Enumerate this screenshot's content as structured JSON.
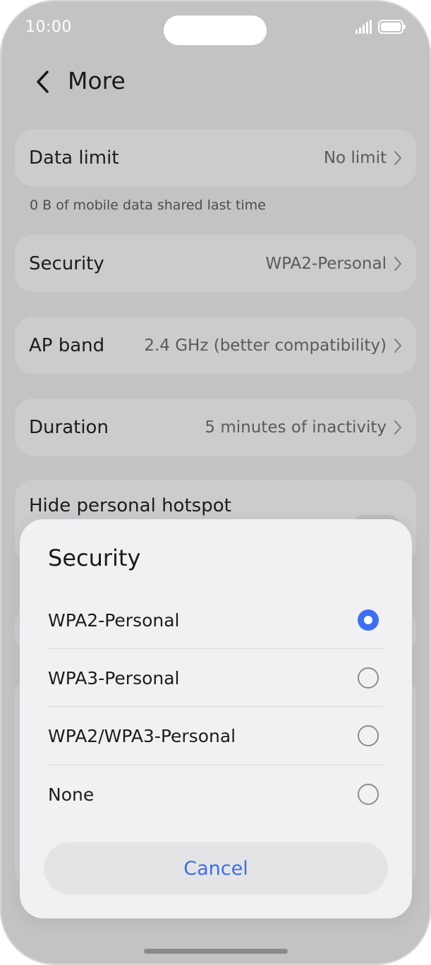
{
  "status_bar": {
    "time": "10:00",
    "signal_icon": "signal-icon",
    "battery_icon": "battery-icon"
  },
  "header": {
    "back_icon": "chevron-left-icon",
    "title": "More"
  },
  "settings": {
    "data_limit": {
      "label": "Data limit",
      "value": "No limit"
    },
    "hint": "0 B of mobile data shared last time",
    "security": {
      "label": "Security",
      "value": "WPA2-Personal"
    },
    "ap_band": {
      "label": "AP band",
      "value": "2.4 GHz (better compatibility)"
    },
    "duration": {
      "label": "Duration",
      "value": "5 minutes of inactivity"
    },
    "hide_hotspot": {
      "label": "Hide personal hotspot"
    }
  },
  "dialog": {
    "title": "Security",
    "options": [
      {
        "label": "WPA2-Personal",
        "selected": true
      },
      {
        "label": "WPA3-Personal",
        "selected": false
      },
      {
        "label": "WPA2/WPA3-Personal",
        "selected": false
      },
      {
        "label": "None",
        "selected": false
      }
    ],
    "cancel_label": "Cancel"
  },
  "colors": {
    "accent": "#3d6ff0",
    "cancel_text": "#3b6de8",
    "backdrop": "#c3c3c5",
    "dialog_bg": "#f1f1f3"
  }
}
